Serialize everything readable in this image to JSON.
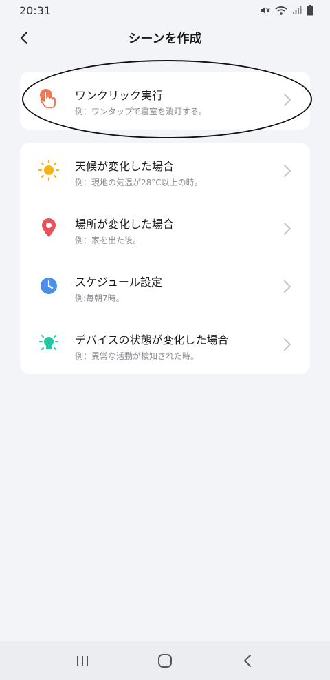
{
  "status_bar": {
    "time": "20:31"
  },
  "header": {
    "title": "シーンを作成"
  },
  "quick": {
    "title": "ワンクリック実行",
    "subtitle": "例：ワンタップで寝室を消灯する。",
    "icon": "tap-hand-icon",
    "color": "#ef6c45"
  },
  "conditions": [
    {
      "title": "天候が変化した場合",
      "subtitle": "例：現地の気温が28°C以上の時。",
      "icon": "sun-icon",
      "color": "#f7b416"
    },
    {
      "title": "場所が変化した場合",
      "subtitle": "例：家を出た後。",
      "icon": "location-pin-icon",
      "color": "#e8535a"
    },
    {
      "title": "スケジュール設定",
      "subtitle": "例:毎朝7時。",
      "icon": "clock-icon",
      "color": "#4c8fe8"
    },
    {
      "title": "デバイスの状態が変化した場合",
      "subtitle": "例：異常な活動が検知された時。",
      "icon": "device-bulb-icon",
      "color": "#1fc8a0"
    }
  ]
}
